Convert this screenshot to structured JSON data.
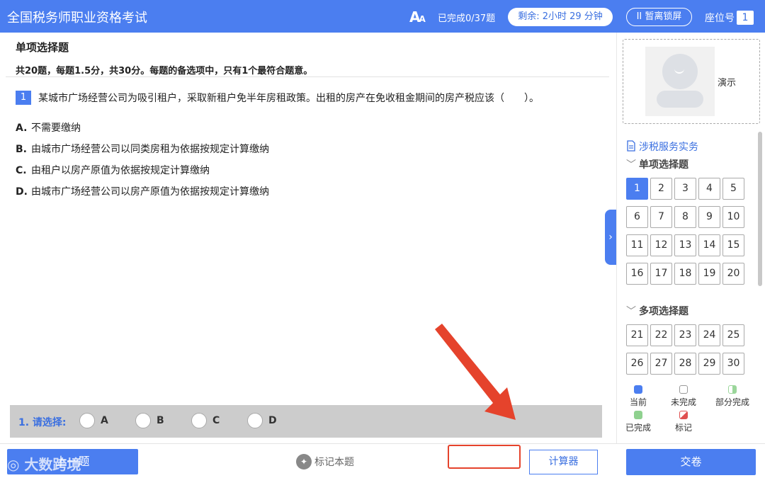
{
  "header": {
    "title": "全国税务师职业资格考试",
    "font_icon": "A",
    "font_icon_small": "A",
    "completed": "已完成0/37题",
    "remaining": "剩余: 2小时 29 分钟",
    "pause": "II 暂离锁屏",
    "seat_label": "座位号",
    "seat_number": "1"
  },
  "section": {
    "title": "单项选择题",
    "description": "共20题，每题1.5分，共30分。每题的备选项中，只有1个最符合题意。"
  },
  "question": {
    "number": "1",
    "text": "某城市广场经营公司为吸引租户，采取新租户免半年房租政策。出租的房产在免收租金期间的房产税应该（　　）。",
    "options": [
      {
        "letter": "A.",
        "text": "不需要缴纳"
      },
      {
        "letter": "B.",
        "text": "由城市广场经营公司以同类房租为依据按规定计算缴纳"
      },
      {
        "letter": "C.",
        "text": "由租户以房产原值为依据按规定计算缴纳"
      },
      {
        "letter": "D.",
        "text": "由城市广场经营公司以房产原值为依据按规定计算缴纳"
      }
    ]
  },
  "answer": {
    "prompt": "1. 请选择:",
    "choices": [
      "A",
      "B",
      "C",
      "D"
    ]
  },
  "bottom": {
    "prev": "上一题",
    "watermark": "大数跨境",
    "mark": "标记本题",
    "calculator": "计算器",
    "submit": "交卷"
  },
  "side": {
    "demo_label": "演示",
    "subject": "涉税服务实务",
    "group1_title": "单项选择题",
    "group1_questions": [
      "1",
      "2",
      "3",
      "4",
      "5",
      "6",
      "7",
      "8",
      "9",
      "10",
      "11",
      "12",
      "13",
      "14",
      "15",
      "16",
      "17",
      "18",
      "19",
      "20"
    ],
    "group2_title": "多项选择题",
    "group2_questions": [
      "21",
      "22",
      "23",
      "24",
      "25",
      "26",
      "27",
      "28",
      "29",
      "30"
    ],
    "current_question": "1",
    "legend": {
      "current": "当前",
      "undone": "未完成",
      "partial": "部分完成",
      "done": "已完成",
      "marked": "标记"
    }
  },
  "colors": {
    "accent": "#4b7ef0",
    "arrow": "#e5432c"
  }
}
